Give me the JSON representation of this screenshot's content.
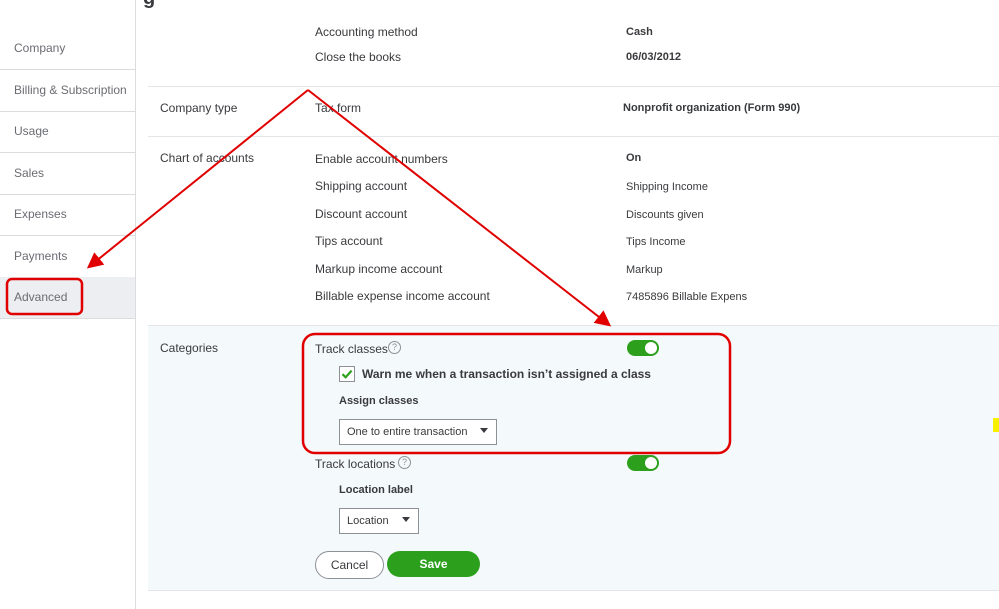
{
  "sidebar": {
    "items": [
      {
        "label": "Company"
      },
      {
        "label": "Billing & Subscription"
      },
      {
        "label": "Usage"
      },
      {
        "label": "Sales"
      },
      {
        "label": "Expenses"
      },
      {
        "label": "Payments"
      },
      {
        "label": "Advanced",
        "active": true
      }
    ]
  },
  "accounting": {
    "method_label": "Accounting method",
    "method_value": "Cash",
    "close_label": "Close the books",
    "close_value": "06/03/2012"
  },
  "company_type": {
    "title": "Company type",
    "tax_form_label": "Tax form",
    "tax_form_value": "Nonprofit organization (Form 990)"
  },
  "chart_of_accounts": {
    "title": "Chart of accounts",
    "rows": [
      {
        "label": "Enable account numbers",
        "value": "On"
      },
      {
        "label": "Shipping account",
        "value": "Shipping Income"
      },
      {
        "label": "Discount account",
        "value": "Discounts given"
      },
      {
        "label": "Tips account",
        "value": "Tips Income"
      },
      {
        "label": "Markup income account",
        "value": "Markup"
      },
      {
        "label": "Billable expense income account",
        "value": "7485896 Billable Expens"
      }
    ]
  },
  "categories": {
    "title": "Categories",
    "track_classes_label": "Track classes",
    "track_classes_on": true,
    "warn_label": "Warn me when a transaction isn’t assigned a class",
    "warn_checked": true,
    "assign_classes_label": "Assign classes",
    "assign_classes_value": "One to entire transaction",
    "track_locations_label": "Track locations",
    "track_locations_on": true,
    "location_label_label": "Location label",
    "location_label_value": "Location",
    "help_glyph": "?"
  },
  "actions": {
    "cancel_label": "Cancel",
    "save_label": "Save"
  },
  "colors": {
    "accent_green": "#2ca01c",
    "annotation_red": "#e00000"
  },
  "icons": [
    "help-icon",
    "checkmark-icon",
    "caret-down-icon"
  ]
}
